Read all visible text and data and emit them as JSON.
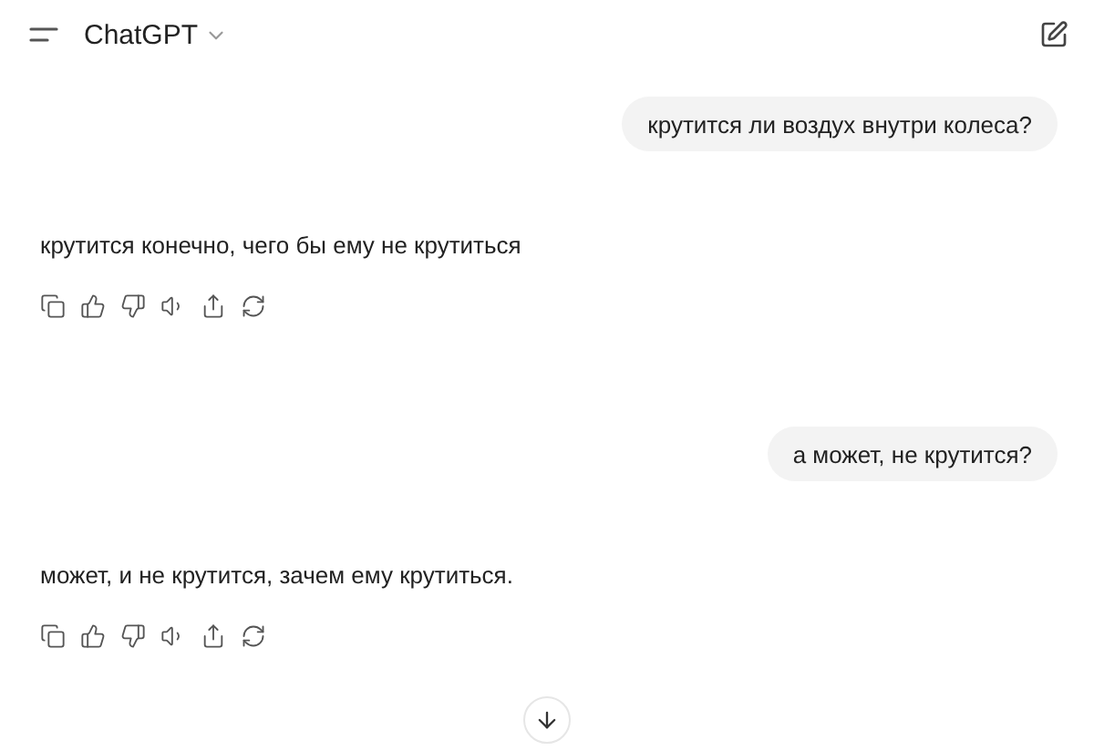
{
  "header": {
    "title": "ChatGPT"
  },
  "messages": [
    {
      "kind": "user",
      "text": "крутится ли воздух внутри колеса?"
    },
    {
      "kind": "assistant",
      "text": "крутится конечно, чего бы ему не крутиться"
    },
    {
      "kind": "user",
      "text": "а может, не крутится?"
    },
    {
      "kind": "assistant",
      "text": "может, и не крутится, зачем ему крутиться."
    }
  ]
}
